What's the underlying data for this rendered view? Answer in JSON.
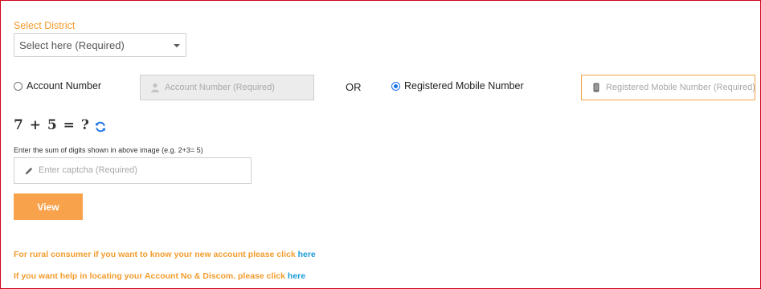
{
  "district": {
    "label": "Select District",
    "select_value": "Select here (Required)"
  },
  "lookup": {
    "account_radio_label": "Account Number",
    "account_placeholder": "Account Number (Required)",
    "or_text": "OR",
    "mobile_radio_label": "Registered Mobile Number",
    "mobile_placeholder": "Registered Mobile Number (Required)",
    "selected_option": "mobile"
  },
  "captcha": {
    "expression": "7 + 5 = ?",
    "hint": "Enter the sum of digits shown in above image (e.g. 2+3= 5)",
    "placeholder": "Enter captcha (Required)"
  },
  "actions": {
    "view_label": "View"
  },
  "help_links": [
    {
      "text": "For rural consumer if you want to know your new account please click ",
      "link_label": "here"
    },
    {
      "text": "If you want help in locating your Account No & Discom. please click ",
      "link_label": "here"
    }
  ],
  "colors": {
    "accent_orange": "#f39c2d",
    "button_orange": "#f9a24c",
    "link_blue": "#1a9bd8",
    "radio_blue": "#1a73e8",
    "frame_red": "#d0021b"
  },
  "icons": {
    "account_input": "account-icon",
    "mobile_input": "mobile-phone-icon",
    "captcha_input": "pencil-icon",
    "refresh": "refresh-icon"
  }
}
